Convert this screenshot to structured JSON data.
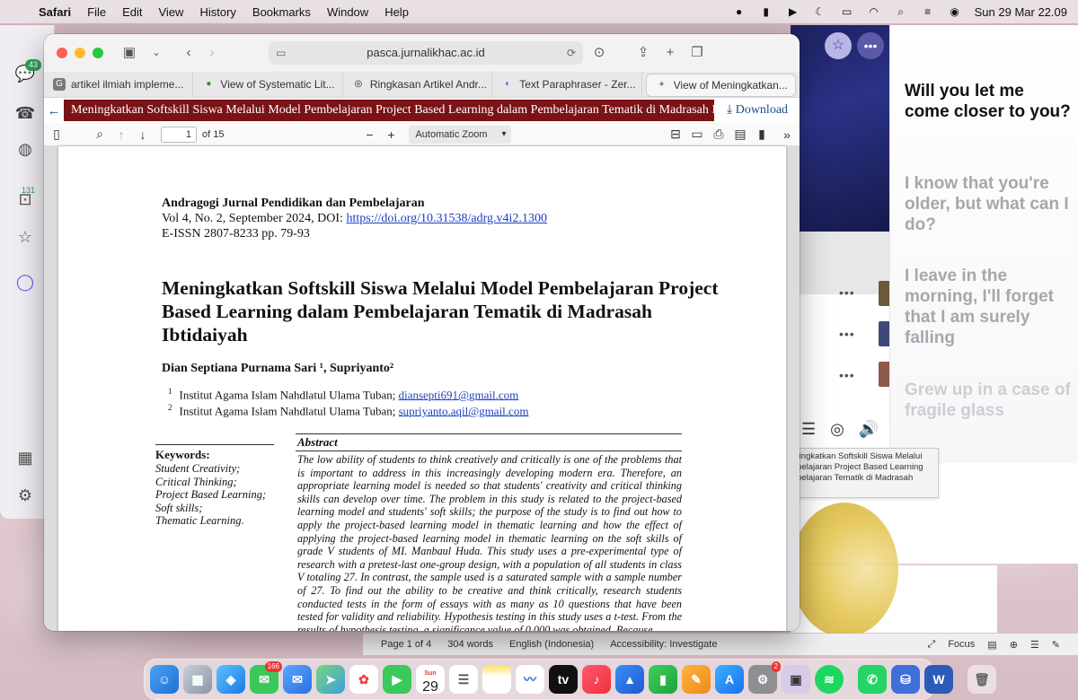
{
  "menubar": {
    "app": "Safari",
    "items": [
      "File",
      "Edit",
      "View",
      "History",
      "Bookmarks",
      "Window",
      "Help"
    ],
    "datetime": "Sun 29 Mar  22.09"
  },
  "leftapp": {
    "chat_badge": "43",
    "calendar_badge": "131"
  },
  "safari": {
    "url": "pasca.jurnalikhac.ac.id",
    "tabs": [
      {
        "label": "artikel ilmiah impleme...",
        "color": "#7a7a7a",
        "glyph": "G"
      },
      {
        "label": "View of Systematic Lit...",
        "color": "#3c8a2e",
        "glyph": "●"
      },
      {
        "label": "Ringkasan Artikel Andr...",
        "color": "#222222",
        "glyph": "◎"
      },
      {
        "label": "Text Paraphraser - Zer...",
        "color": "#2c6fd6",
        "glyph": "◐"
      },
      {
        "label": "View of Meningkatkan...",
        "color": "#5aa25a",
        "glyph": "✦"
      }
    ],
    "pdf_title": "Meningkatkan Softskill Siswa Melalui Model Pembelajaran Project Based Learning dalam Pembelajaran Tematik di Madrasah Ibtidaiyah",
    "download_label": "Download",
    "page_number": "1",
    "page_count": "of 15",
    "zoom": "Automatic Zoom"
  },
  "document": {
    "journal_name": "Andragogi Jurnal Pendidikan dan Pembelajaran",
    "volume": "Vol 4, No. 2, September 2024,  DOI: ",
    "doi": "https://doi.org/10.31538/adrg.v4i2.1300",
    "issn": "E-ISSN 2807-8233    pp. 79-93",
    "title": "Meningkatkan Softskill Siswa Melalui Model Pembelajaran Project Based Learning dalam Pembelajaran Tematik di Madrasah Ibtidaiyah",
    "authors": "Dian Septiana Purnama Sari ¹, Supriyanto²",
    "affiliations": [
      {
        "num": "1",
        "text": "Institut Agama Islam Nahdlatul Ulama Tuban; ",
        "email": "diansepti691@gmail.com"
      },
      {
        "num": "2",
        "text": "Institut Agama Islam Nahdlatul Ulama Tuban; ",
        "email": "supriyanto.aqil@gmail.com"
      }
    ],
    "keywords_heading": "Keywords:",
    "keywords": [
      "Student Creativity;",
      "Critical Thinking;",
      "Project Based Learning;",
      "Soft skills;",
      "Thematic Learning."
    ],
    "abstract_heading": "Abstract",
    "abstract": "The low ability of students to think creatively and critically is one of the problems that is important to address in this increasingly developing modern era. Therefore, an appropriate learning model is needed so that students' creativity and critical thinking skills can develop over time. The problem in this study is related to the project-based learning model and students' soft skills; the purpose of the study is to find out how to apply the project-based learning model in thematic learning and how the effect of applying the project-based learning model in thematic learning on the soft skills of grade V students of MI. Manbaul Huda. This study uses a pre-experimental type of research with a pretest-last one-group design, with a population of all students in class V totaling 27. In contrast, the sample used is a saturated sample with a sample number of 27. To find out the ability to be creative and think critically, research students conducted tests in the form of essays with as many as 10 questions that have been tested for validity and reliability. Hypothesis testing in this study uses a t-test. From the results of hypothesis testing, a significance value of 0.000 was obtained. Because"
  },
  "lyrics": {
    "lines": [
      "Will you let me come closer to you?",
      "I know that you're older, but what can I do?",
      "I leave in the morning, I'll forget that I am surely falling",
      "Grew up in a case of fragile glass"
    ]
  },
  "tooltip": "PDF of Meningkatkan Softskill Siswa Melalui Model Pembelajaran Project Based Learning dalam Pembelajaran Tematik di Madrasah Ibtidaiyah",
  "wordbar": {
    "page": "Page 1 of 4",
    "words": "304 words",
    "language": "English (Indonesia)",
    "accessibility": "Accessibility: Investigate",
    "focus": "Focus"
  },
  "dock": {
    "messages_badge": "166",
    "calendar_day": "29",
    "calendar_month": "Sun",
    "settings_badge": "2"
  }
}
